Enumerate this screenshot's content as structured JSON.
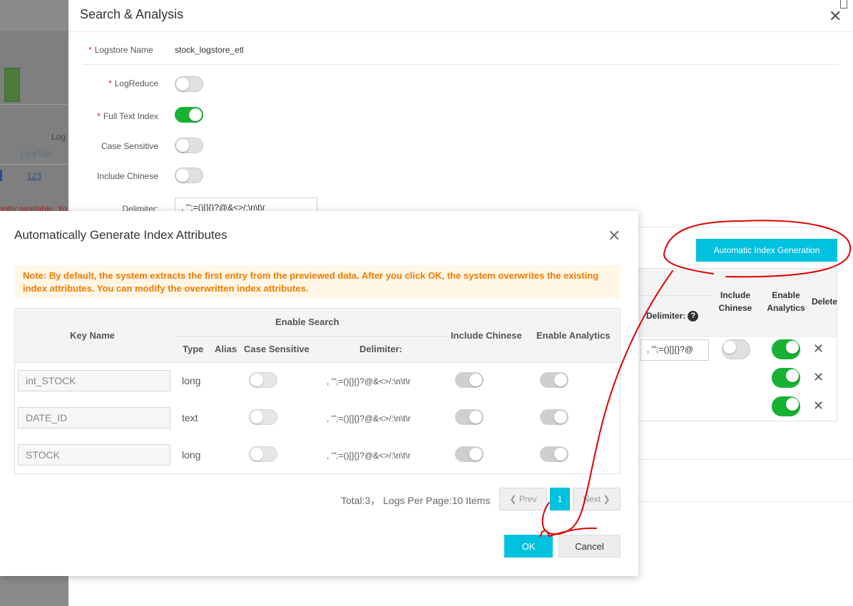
{
  "background_app": {
    "log_text": "Log",
    "livetail_label": "LiveTail",
    "count_link": "123",
    "warning_fragment": "rently available. Yo"
  },
  "panel": {
    "title": "Search & Analysis",
    "fields": {
      "logstore_name_label": "Logstore Name",
      "logstore_name_value": "stock_logstore_etl",
      "logreduce_label": "LogReduce",
      "full_text_index_label": "Full Text Index",
      "case_sensitive_label": "Case Sensitive",
      "include_chinese_label": "Include Chinese",
      "delimiter_label": "Delimiter:",
      "delimiter_value": ", '\";=()[]{}?@&<>/:\\n\\t\\r"
    },
    "toggles": {
      "logreduce": false,
      "full_text_index": true,
      "case_sensitive": false,
      "include_chinese": false
    },
    "auto_button_label": "Automatic Index Generation",
    "table_headers": {
      "delimiter": "Delimiter:",
      "include_chinese_1": "Include",
      "include_chinese_2": "Chinese",
      "enable_analytics_1": "Enable",
      "enable_analytics_2": "Analytics",
      "delete": "Delete"
    },
    "first_row_delimiter": ", '\";=()[]{}?@"
  },
  "modal": {
    "title": "Automatically Generate Index Attributes",
    "note": "Note: By default, the system extracts the first entry from the previewed data. After you click OK, the system overwrites the existing index attributes. You can modify the overwritten index attributes.",
    "headers": {
      "key_name": "Key Name",
      "enable_search": "Enable Search",
      "type": "Type",
      "alias": "Alias",
      "case_sensitive": "Case Sensitive",
      "delimiter": "Delimiter:",
      "include_chinese": "Include Chinese",
      "enable_analytics": "Enable Analytics"
    },
    "rows": [
      {
        "key": "int_STOCK",
        "type": "long",
        "delimiter": ", '\";=()[]{}?@&<>/:\\n\\t\\r"
      },
      {
        "key": "DATE_ID",
        "type": "text",
        "delimiter": ", '\";=()[]{}?@&<>/:\\n\\t\\r"
      },
      {
        "key": "STOCK",
        "type": "long",
        "delimiter": ", '\";=()[]{}?@&<>/:\\n\\t\\r"
      }
    ],
    "pagination": {
      "total_text": "Total:3， Logs Per Page:10 Items",
      "prev_label": "Prev",
      "current_page": "1",
      "next_label": "Next"
    },
    "ok_label": "OK",
    "cancel_label": "Cancel"
  },
  "colors": {
    "accent": "#00c1de",
    "toggle_on": "#18b232",
    "note_text": "#f07b00",
    "note_bg": "#fff6e5",
    "annotation": "#e00000"
  }
}
